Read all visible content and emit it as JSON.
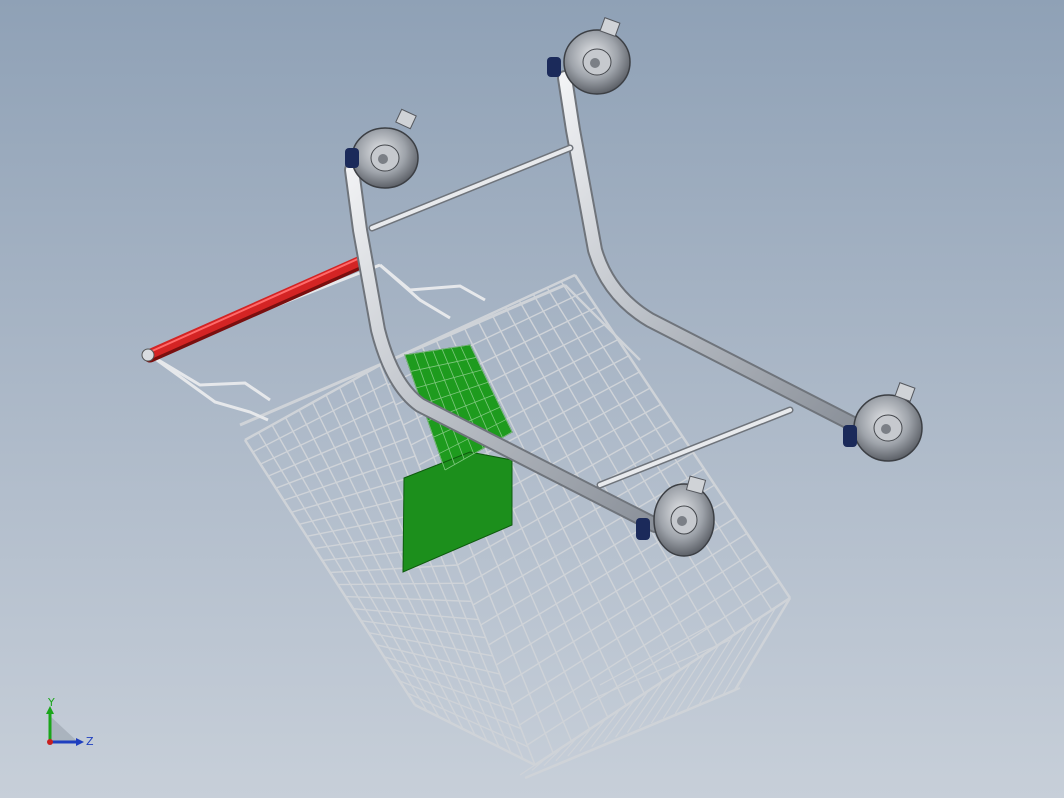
{
  "viewport": {
    "background_top": "#8fa1b6",
    "background_bottom": "#c7cfd9"
  },
  "model": {
    "frame_color": "#c9cdd2",
    "handle_color": "#cc1f1f",
    "panel_color": "#1e9b1e",
    "wheel_color": "#7b7f86",
    "wire_color": "#cfd3d8"
  },
  "triad": {
    "y_label": "Y",
    "z_label": "Z",
    "y_color": "#1aa51a",
    "z_color": "#1f3fbf",
    "x_color": "#c81f1f"
  }
}
